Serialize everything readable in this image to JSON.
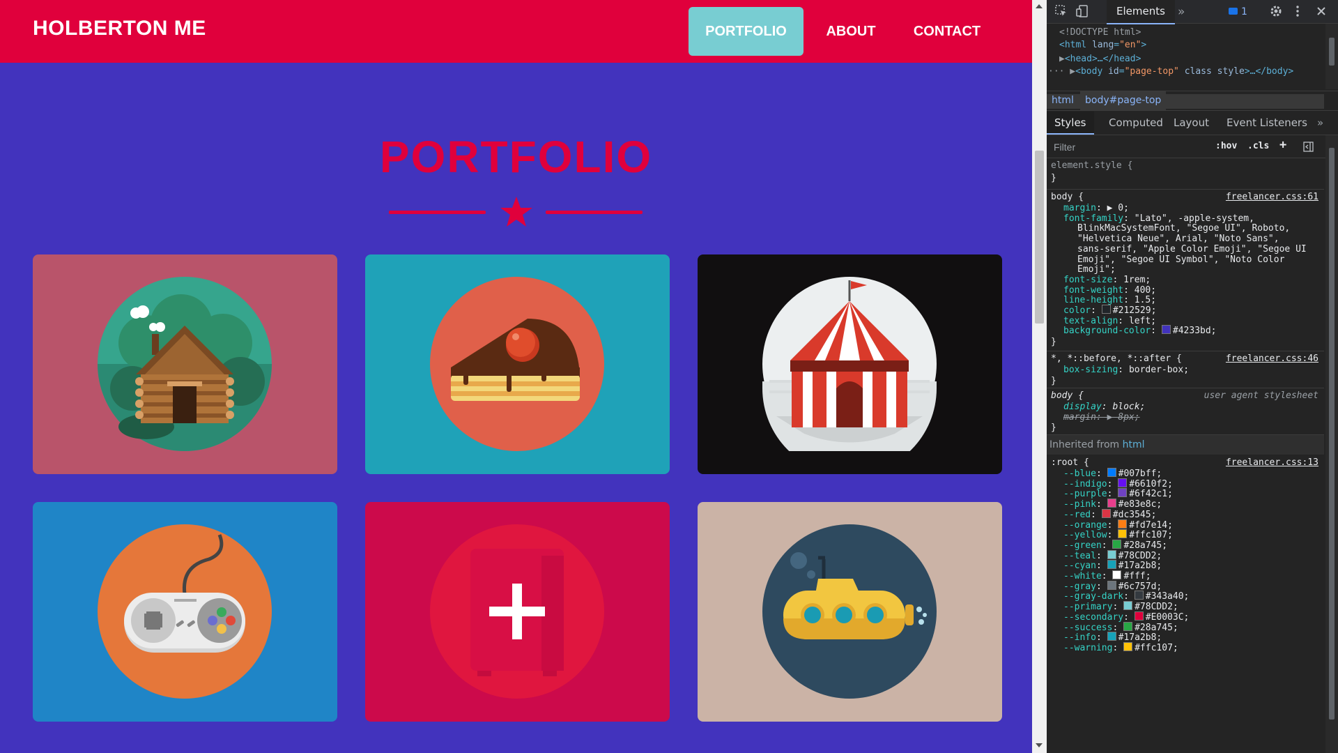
{
  "page": {
    "brand": "HOLBERTON ME",
    "nav": [
      "PORTFOLIO",
      "ABOUT",
      "CONTACT"
    ],
    "active_nav": "PORTFOLIO",
    "section_title": "PORTFOLIO",
    "colors": {
      "primary": "#78CDD2",
      "secondary": "#E0003C",
      "background": "#4233bd"
    },
    "tiles": [
      {
        "subject": "cabin",
        "bg": "#b9546a"
      },
      {
        "subject": "cake",
        "bg": "#1fa2b8"
      },
      {
        "subject": "circus-tent",
        "bg": "#110f10"
      },
      {
        "subject": "game-controller",
        "bg": "#1f85c7"
      },
      {
        "subject": "safe",
        "bg": "#cc0a4b"
      },
      {
        "subject": "submarine",
        "bg": "#cbb3a6"
      }
    ]
  },
  "devtools": {
    "active_tab": "Elements",
    "more": "»",
    "issues_count": "1",
    "dom": {
      "doctype": "<!DOCTYPE html>",
      "html_open": "<html",
      "html_attr": "lang",
      "html_attr_val": "\"en\"",
      "head": "<head>…</head>",
      "body_tag": "<body",
      "body_attr1": "id",
      "body_attr1_val": "\"page-top\"",
      "body_attr2": "class style",
      "body_rest": ">…</body>"
    },
    "breadcrumbs": [
      "html",
      "body#page-top"
    ],
    "subtabs": [
      "Styles",
      "Computed",
      "Layout",
      "Event Listeners"
    ],
    "filter_placeholder": "Filter",
    "filter_buttons": [
      ":hov",
      ".cls",
      "+"
    ],
    "rules": {
      "element_style": {
        "selector": "element.style {",
        "close": "}"
      },
      "body1": {
        "selector": "body {",
        "source": "freelancer.css:61",
        "props": [
          {
            "name": "margin",
            "value": "0;",
            "arrow": true
          },
          {
            "name": "font-family",
            "value": "\"Lato\", -apple-system,"
          },
          {
            "cont": "BlinkMacSystemFont, \"Segoe UI\", Roboto,"
          },
          {
            "cont": "\"Helvetica Neue\", Arial, \"Noto Sans\","
          },
          {
            "cont": "sans-serif, \"Apple Color Emoji\", \"Segoe UI"
          },
          {
            "cont": "Emoji\", \"Segoe UI Symbol\", \"Noto Color"
          },
          {
            "cont": "Emoji\";"
          },
          {
            "name": "font-size",
            "value": "1rem;"
          },
          {
            "name": "font-weight",
            "value": "400;"
          },
          {
            "name": "line-height",
            "value": "1.5;"
          },
          {
            "name": "color",
            "value": "#212529;",
            "swatch": "#212529"
          },
          {
            "name": "text-align",
            "value": "left;"
          },
          {
            "name": "background-color",
            "value": "#4233bd;",
            "swatch": "#4233bd"
          }
        ],
        "close": "}"
      },
      "universal": {
        "selector": "*, *::before, *::after {",
        "source": "freelancer.css:46",
        "props": [
          {
            "name": "box-sizing",
            "value": "border-box;"
          }
        ],
        "close": "}"
      },
      "body_ua": {
        "selector": "body {",
        "source": "user agent stylesheet",
        "props": [
          {
            "name": "display",
            "value": "block;"
          },
          {
            "name": "margin",
            "value": "8px;",
            "struck": true
          }
        ],
        "close": "}"
      },
      "inherited_label": "Inherited from",
      "inherited_tag": "html",
      "root": {
        "selector": ":root {",
        "source": "freelancer.css:13",
        "vars": [
          {
            "name": "--blue",
            "value": "#007bff;",
            "swatch": "#007bff"
          },
          {
            "name": "--indigo",
            "value": "#6610f2;",
            "swatch": "#6610f2"
          },
          {
            "name": "--purple",
            "value": "#6f42c1;",
            "swatch": "#6f42c1"
          },
          {
            "name": "--pink",
            "value": "#e83e8c;",
            "swatch": "#e83e8c"
          },
          {
            "name": "--red",
            "value": "#dc3545;",
            "swatch": "#dc3545"
          },
          {
            "name": "--orange",
            "value": "#fd7e14;",
            "swatch": "#fd7e14"
          },
          {
            "name": "--yellow",
            "value": "#ffc107;",
            "swatch": "#ffc107"
          },
          {
            "name": "--green",
            "value": "#28a745;",
            "swatch": "#28a745"
          },
          {
            "name": "--teal",
            "value": "#78CDD2;",
            "swatch": "#78CDD2"
          },
          {
            "name": "--cyan",
            "value": "#17a2b8;",
            "swatch": "#17a2b8"
          },
          {
            "name": "--white",
            "value": "#fff;",
            "swatch": "#ffffff"
          },
          {
            "name": "--gray",
            "value": "#6c757d;",
            "swatch": "#6c757d"
          },
          {
            "name": "--gray-dark",
            "value": "#343a40;",
            "swatch": "#343a40"
          },
          {
            "name": "--primary",
            "value": "#78CDD2;",
            "swatch": "#78CDD2"
          },
          {
            "name": "--secondary",
            "value": "#E0003C;",
            "swatch": "#E0003C"
          },
          {
            "name": "--success",
            "value": "#28a745;",
            "swatch": "#28a745"
          },
          {
            "name": "--info",
            "value": "#17a2b8;",
            "swatch": "#17a2b8"
          },
          {
            "name": "--warning",
            "value": "#ffc107;",
            "swatch": "#ffc107"
          }
        ]
      }
    }
  }
}
